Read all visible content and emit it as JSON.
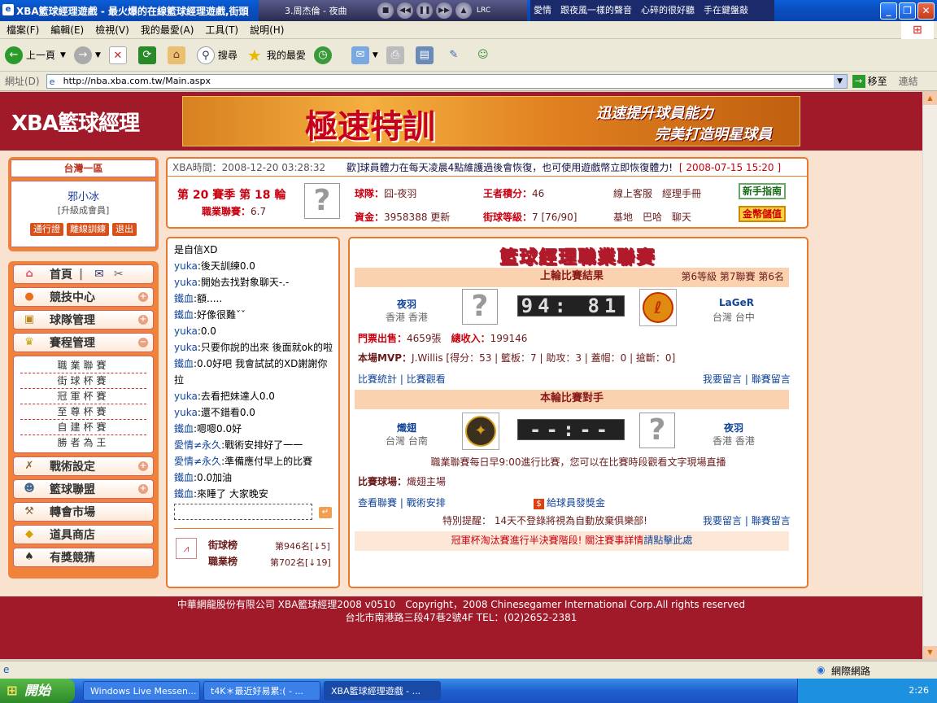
{
  "window": {
    "title": "XBA籃球經理遊戲 - 最火爆的在線籃球經理遊戲,街頭",
    "media_player": {
      "track": "3.周杰倫 - 夜曲",
      "lrc": "LRC"
    },
    "lyric": "愛情　跟夜風一樣的聲音　心碎的很好聽　手在鍵盤敲"
  },
  "menu": [
    "檔案(F)",
    "編輯(E)",
    "檢視(V)",
    "我的最愛(A)",
    "工具(T)",
    "說明(H)"
  ],
  "toolbar": {
    "back": "上一頁",
    "search": "搜尋",
    "favorites": "我的最愛"
  },
  "address": {
    "label": "網址(D)",
    "url": "http://nba.xba.com.tw/Main.aspx",
    "go": "移至",
    "links": "連結"
  },
  "site": {
    "logo": "XBA籃球經理",
    "banner_title": "極速特訓",
    "banner_line1": "迅速提升球員能力",
    "banner_line2": "完美打造明星球員"
  },
  "user": {
    "server": "台灣一區",
    "name": "邪小冰",
    "level": "[升級成會員]",
    "buttons": [
      "通行證",
      "離線訓練",
      "退出"
    ]
  },
  "nav": {
    "home": "首頁",
    "items": [
      "競技中心",
      "球隊管理",
      "賽程管理"
    ],
    "sub": [
      "職業聯賽",
      "街球杯賽",
      "冠軍杯賽",
      "至尊杯賽",
      "自建杯賽",
      "勝者為王"
    ],
    "items2": [
      "戰術設定",
      "籃球聯盟",
      "轉會市場",
      "道具商店",
      "有獎競猜"
    ]
  },
  "info": {
    "time_label": "XBA時間：",
    "time": "2008-12-20 03:28:32",
    "notice": "歡]球員體力在每天凌晨4點維護過後會恢復，也可使用遊戲幣立即恢復體力!",
    "notice_date": "[ 2008-07-15 15:20 ]",
    "season": "第 20 賽季 第 18 輪",
    "league_score_label": "職業聯賽：",
    "league_score": "6.7",
    "team_label": "球隊：",
    "team": "囧-夜羽",
    "king_label": "王者積分：",
    "king": "46",
    "links1": "線上客服　經理手冊",
    "funds_label": "資金：",
    "funds": "3958388",
    "update": "更新",
    "street_label": "街球等級：",
    "street": "7 [76/90]",
    "links2": "基地　巴哈　聊天",
    "btn_guide": "新手指南",
    "btn_gold": "金幣儲值"
  },
  "chat": {
    "lines": [
      {
        "u": "",
        "t": "是自信XD"
      },
      {
        "u": "yuka",
        "t": ":後天訓練0.0"
      },
      {
        "u": "yuka",
        "t": ":開始去找對象聊天-.-"
      },
      {
        "u": "鐵血",
        "t": ":額....."
      },
      {
        "u": "鐵血",
        "t": ":好像很難ˇˇ"
      },
      {
        "u": "yuka",
        "t": ":0.0"
      },
      {
        "u": "yuka",
        "t": ":只要你說的出來 後面就ok的啦"
      },
      {
        "u": "鐵血",
        "t": ":0.0好吧 我會試試的XD謝謝你拉"
      },
      {
        "u": "yuka",
        "t": ":去看把妹達人0.0"
      },
      {
        "u": "yuka",
        "t": ":還不錯看0.0"
      },
      {
        "u": "鐵血",
        "t": ":嗯嗯0.0好"
      },
      {
        "u": "愛情≠永久",
        "t": ":戰術安排好了一一"
      },
      {
        "u": "愛情≠永久",
        "t": ":準備應付早上的比賽"
      },
      {
        "u": "鐵血",
        "t": ":0.0加油"
      },
      {
        "u": "鐵血",
        "t": ":來睡了 大家晚安"
      }
    ],
    "rank1_label": "街球榜",
    "rank1": "第946名[↓5]",
    "rank2_label": "職業榜",
    "rank2": "第702名[↓19]"
  },
  "league": {
    "title": "籃球經理職業聯賽",
    "last_header": "上輪比賽結果",
    "level": "第6等級 第7聯賽 第6名",
    "home_team": "夜羽",
    "home_loc": "香港 香港",
    "score": "94: 81",
    "away_team": "LaGeR",
    "away_loc": "台灣 台中",
    "ticket_label": "門票出售：",
    "ticket": "4659張",
    "income_label": "總收入：",
    "income": "199146",
    "mvp_label": "本場MVP：",
    "mvp": "J.Willis [得分：53 | 籃板：7 | 助攻：3 | 蓋帽：0 | 搶斷：0]",
    "stats": "比賽統計",
    "watch": "比賽觀看",
    "msg": "我要留言",
    "league_msg": "聯賽留言",
    "next_header": "本輪比賽對手",
    "next_home": "熾翅",
    "next_home_loc": "台灣 台南",
    "next_score": "--:--",
    "next_away": "夜羽",
    "next_away_loc": "香港 香港",
    "schedule": "職業聯賽每日早9:00進行比賽，您可以在比賽時段觀看文字現場直播",
    "venue_label": "比賽球場：",
    "venue": "熾翅主場",
    "view_league": "查看聯賽",
    "tactics": "戰術安排",
    "bonus": "給球員發獎金",
    "warning": "特別提醒： 14天不登錄將視為自動放棄俱樂部!",
    "cup": "冠軍杯淘汰賽進行半決賽階段! 關注賽事詳情",
    "cup_link": "請點擊此處"
  },
  "footer": {
    "line1": "中華網龍股份有限公司 XBA籃球經理2008 v0510　Copyright，2008 Chinesegamer International Corp.All rights reserved",
    "line2": "台北市南港路三段47巷2號4F TEL：(02)2652-2381"
  },
  "status": {
    "zone": "網際網路"
  },
  "taskbar": {
    "start": "開始",
    "tasks": [
      "Windows Live Messen...",
      "t4K＊最近好易累:( - ...",
      "XBA籃球經理遊戲 - ..."
    ],
    "clock": "2:26"
  }
}
